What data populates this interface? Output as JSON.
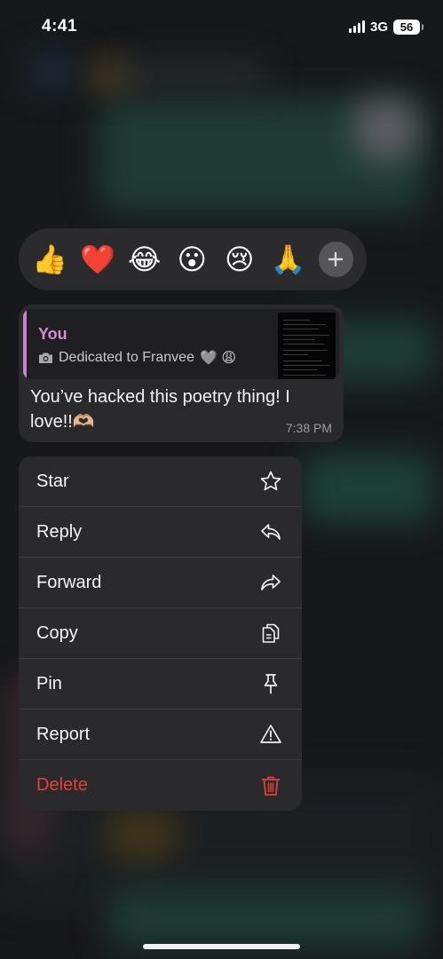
{
  "status_bar": {
    "time": "4:41",
    "network": "3G",
    "battery": "56"
  },
  "reactions": [
    {
      "emoji": "👍",
      "icon": "thumbs-up-icon"
    },
    {
      "emoji": "❤️",
      "icon": "heart-icon"
    },
    {
      "emoji": "😂",
      "icon": "tears-of-joy-icon"
    },
    {
      "emoji": "😮",
      "icon": "surprised-face-icon"
    },
    {
      "emoji": "😢",
      "icon": "crying-face-icon"
    },
    {
      "emoji": "🙏",
      "icon": "folded-hands-icon"
    }
  ],
  "message": {
    "quote_author": "You",
    "quote_text": "Dedicated to Franvee",
    "quote_emojis": "🩶 😩",
    "text": "You’ve hacked this poetry thing! I love!!🫶🏼",
    "time": "7:38 PM"
  },
  "menu": {
    "items": [
      {
        "label": "Star",
        "icon": "star-icon"
      },
      {
        "label": "Reply",
        "icon": "reply-icon"
      },
      {
        "label": "Forward",
        "icon": "forward-icon"
      },
      {
        "label": "Copy",
        "icon": "copy-icon"
      },
      {
        "label": "Pin",
        "icon": "pin-icon"
      },
      {
        "label": "Report",
        "icon": "warning-icon"
      },
      {
        "label": "Delete",
        "icon": "trash-icon"
      }
    ]
  },
  "colors": {
    "accent_quote": "#d889d8",
    "danger": "#e0413b",
    "menu_bg": "#2a2a2c"
  }
}
